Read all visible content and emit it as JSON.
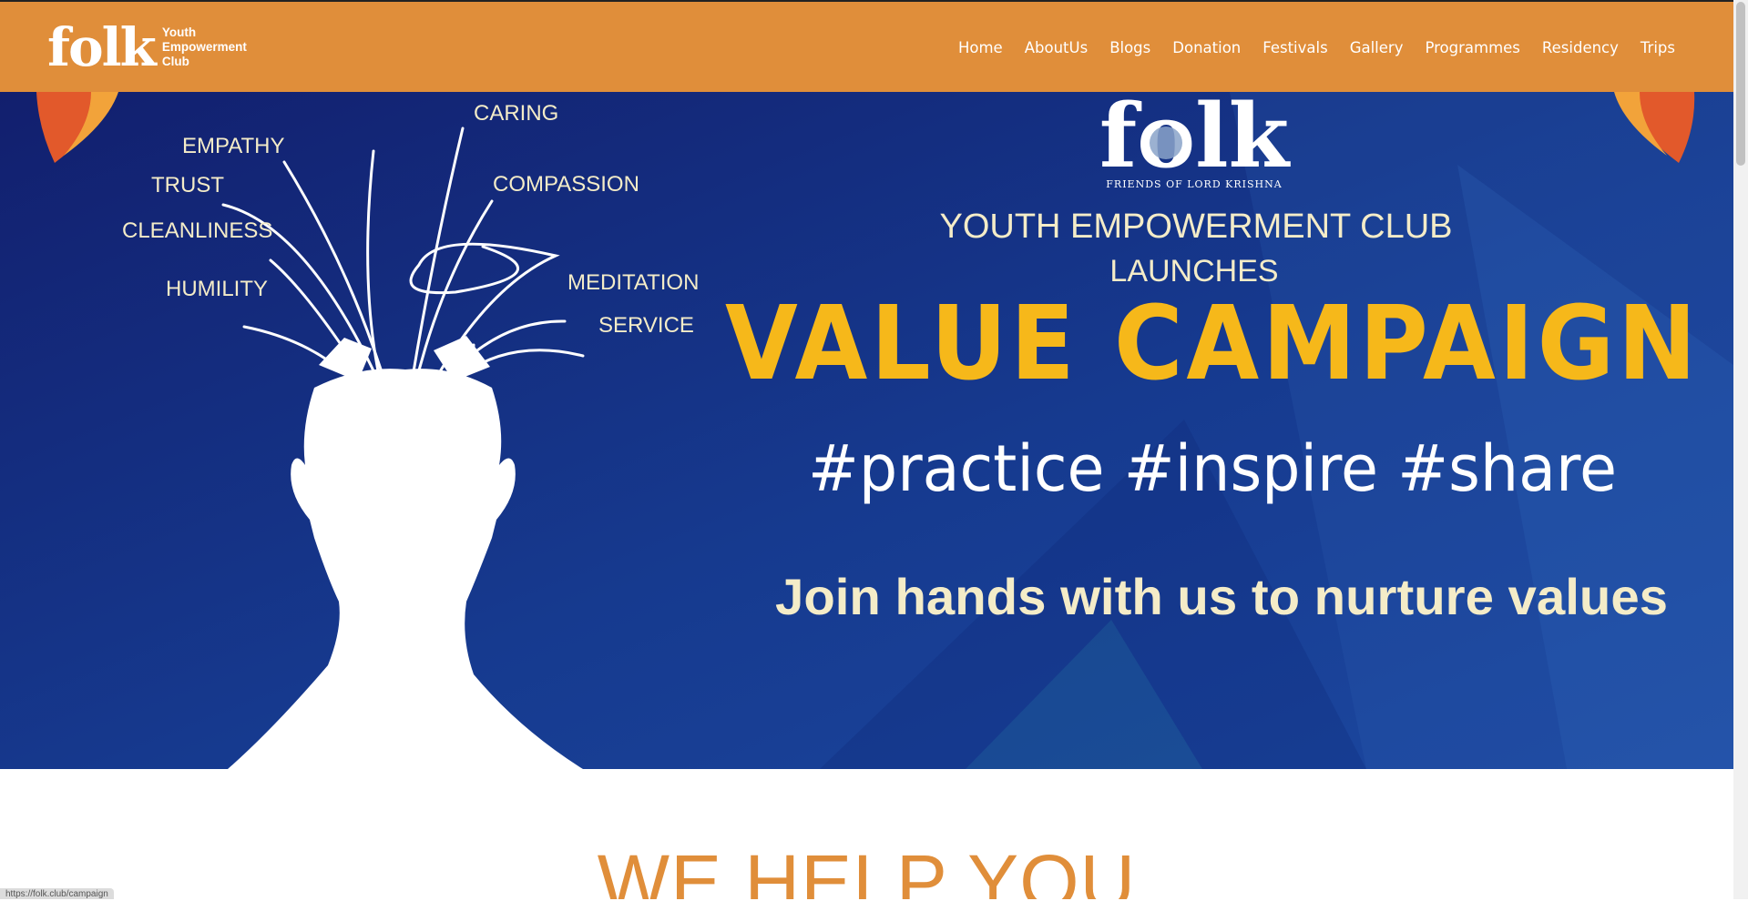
{
  "header": {
    "logo_word": "folk",
    "logo_subtitle": "Youth Empowerment Club",
    "nav": [
      "Home",
      "AboutUs",
      "Blogs",
      "Donation",
      "Festivals",
      "Gallery",
      "Programmes",
      "Residency",
      "Trips"
    ]
  },
  "hero": {
    "values": [
      "CARING",
      "EMPATHY",
      "TRUST",
      "COMPASSION",
      "CLEANLINESS",
      "HUMILITY",
      "MEDITATION",
      "SERVICE"
    ],
    "logo_word": "folk",
    "logo_caption": "FRIENDS OF LORD KRISHNA",
    "club_line": "YOUTH EMPOWERMENT CLUB",
    "launches": "LAUNCHES",
    "campaign": "VALUE CAMPAIGN",
    "hashtags": "#practice #inspire #share",
    "tagline": "Join hands with us to nurture values"
  },
  "section": {
    "heading": "WE HELP YOU"
  },
  "status_url": "https://folk.club/campaign",
  "colors": {
    "header": "#e08e3a",
    "hero_bg": "#123080",
    "campaign_yellow": "#f6b81a",
    "text_cream": "#f4ecc8"
  }
}
